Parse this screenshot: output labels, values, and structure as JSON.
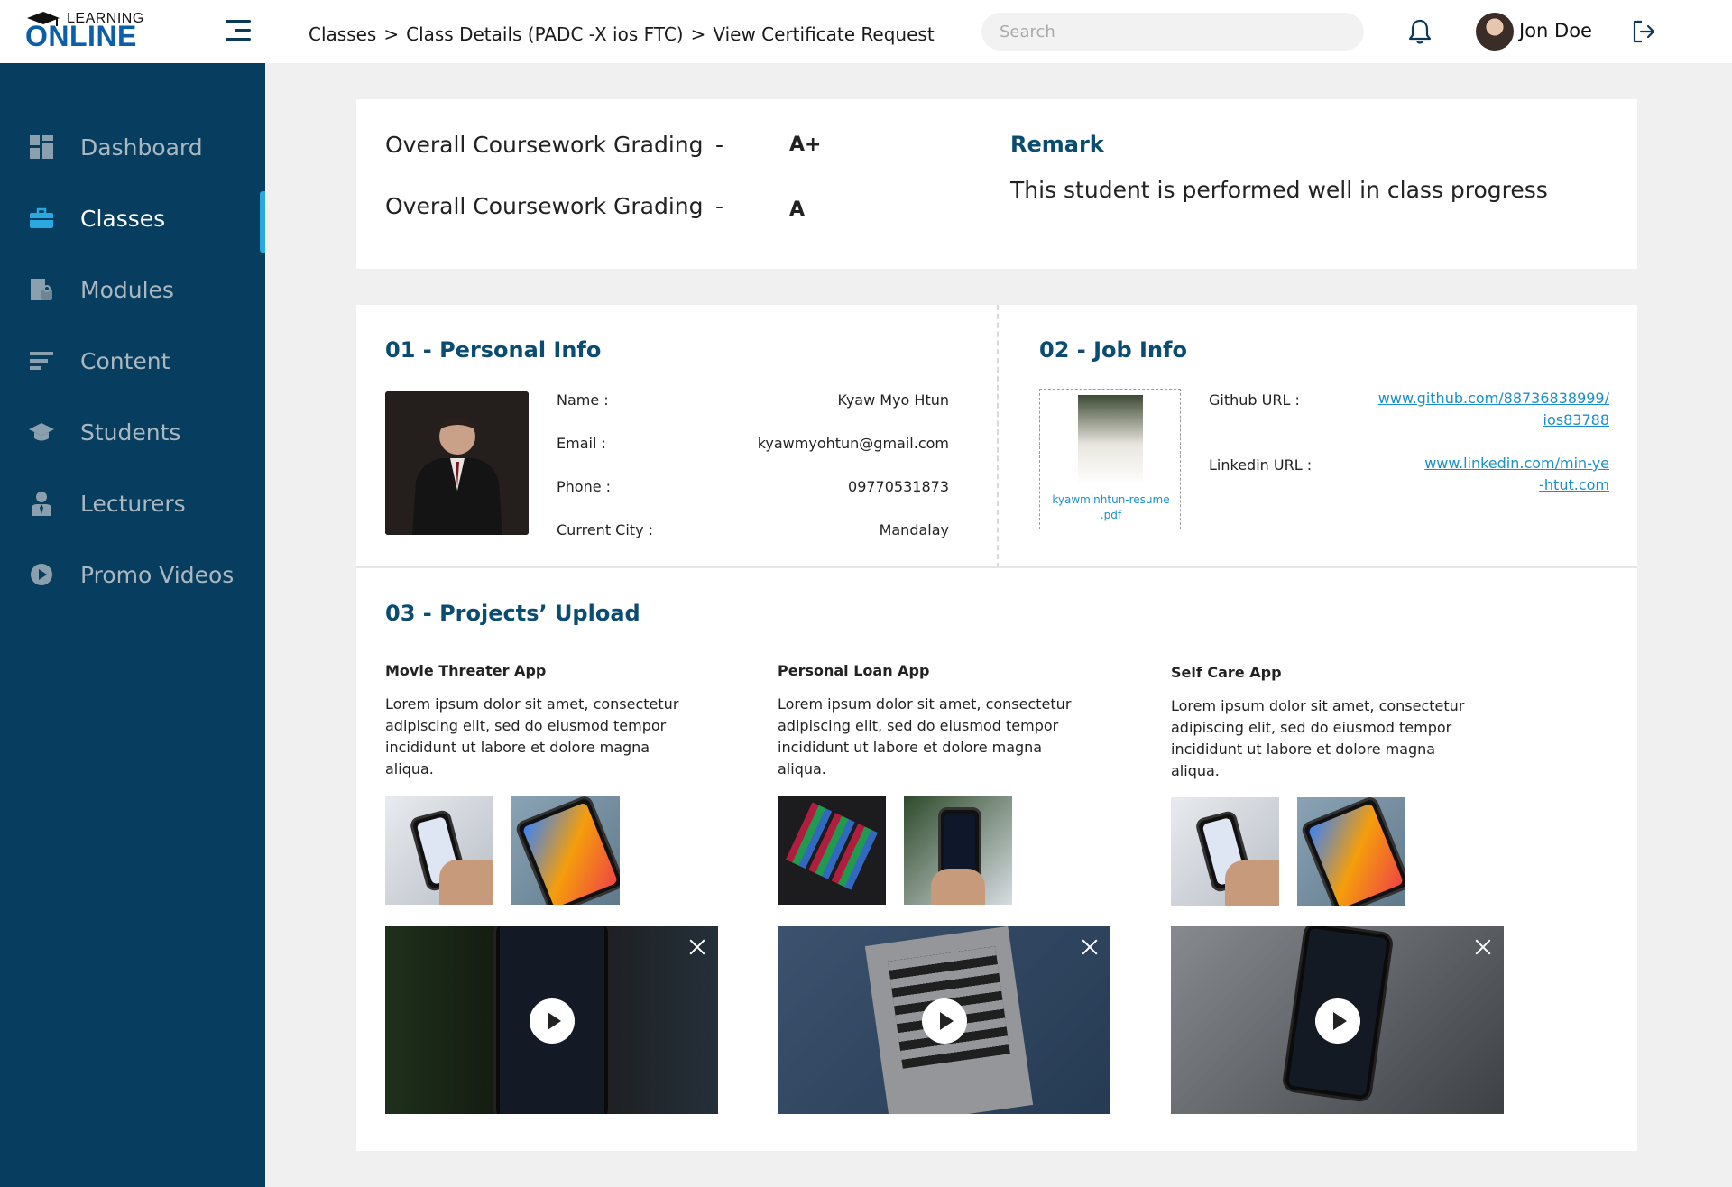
{
  "logo": {
    "small": "LEARNING",
    "big": "ONLINE"
  },
  "breadcrumb": [
    "Classes",
    "Class Details (PADC -X ios FTC)",
    "View Certificate Request"
  ],
  "breadcrumb_sep": ">",
  "search": {
    "placeholder": "Search"
  },
  "user": {
    "name": "Jon Doe"
  },
  "sidebar": {
    "items": [
      {
        "label": "Dashboard",
        "icon": "dashboard-icon"
      },
      {
        "label": "Classes",
        "icon": "briefcase-icon",
        "active": true
      },
      {
        "label": "Modules",
        "icon": "modules-icon"
      },
      {
        "label": "Content",
        "icon": "content-icon"
      },
      {
        "label": "Students",
        "icon": "graduation-cap-icon"
      },
      {
        "label": "Lecturers",
        "icon": "lecturer-icon"
      },
      {
        "label": "Promo Videos",
        "icon": "play-circle-icon"
      }
    ]
  },
  "grading": {
    "rows": [
      {
        "label": "Overall Coursework Grading",
        "dash": "-",
        "value": "A+"
      },
      {
        "label": "Overall Coursework Grading",
        "dash": "-",
        "value": "A"
      }
    ],
    "remark_title": "Remark",
    "remark_text": "This student is performed well in class progress"
  },
  "personal": {
    "title": "01 - Personal Info",
    "fields": [
      {
        "label": "Name :",
        "value": "Kyaw Myo Htun"
      },
      {
        "label": "Email :",
        "value": "kyawmyohtun@gmail.com"
      },
      {
        "label": "Phone :",
        "value": "09770531873"
      },
      {
        "label": "Current City :",
        "value": "Mandalay"
      }
    ]
  },
  "job": {
    "title": "02 - Job Info",
    "resume_name_1": "kyawminhtun-resume",
    "resume_name_2": ".pdf",
    "github_label": "Github URL :",
    "github_1": "www.github.com/88736838999/",
    "github_2": "ios83788",
    "linkedin_label": "Linkedin URL :",
    "linkedin_1": "www.linkedin.com/min-ye",
    "linkedin_2": "-htut.com"
  },
  "projects": {
    "title": "03 - Projects’ Upload",
    "items": [
      {
        "name": "Movie Threater App",
        "desc": "Lorem ipsum dolor sit amet, consectetur adipiscing elit, sed do eiusmod tempor incididunt ut labore et dolore magna aliqua."
      },
      {
        "name": "Personal Loan App",
        "desc": "Lorem ipsum dolor sit amet, consectetur adipiscing elit, sed do eiusmod tempor incididunt ut labore et dolore magna aliqua."
      },
      {
        "name": "Self Care App",
        "desc": "Lorem ipsum dolor sit amet, consectetur adipiscing elit, sed do eiusmod tempor incididunt ut labore et dolore magna aliqua."
      }
    ]
  },
  "colors": {
    "sidebar": "#073d5e",
    "accent": "#0a4c72",
    "link": "#1b8fc9",
    "active_indicator": "#2aa8e0"
  }
}
